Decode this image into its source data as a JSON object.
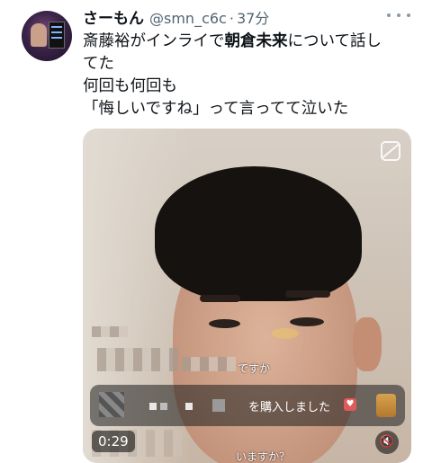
{
  "tweet": {
    "display_name": "さーもん",
    "handle": "@smn_c6c",
    "separator": "·",
    "time": "37分",
    "text": {
      "line1_pre": "斎藤裕がインライで",
      "line1_bold": "朝倉未来",
      "line1_post": "について話し",
      "line2": "てた",
      "line3": "何回も何回も",
      "line4": "「悔しいですね」って言ってて泣いた"
    }
  },
  "media": {
    "timer": "0:29",
    "purchase_text": "を購入しました",
    "comment_1": "ですか",
    "comment_2": "いますか？",
    "live_icon": "live-off-icon",
    "mute_icon": "speaker-muted-icon"
  },
  "icons": {
    "avatar": "user-avatar",
    "more": "more-horizontal-icon"
  },
  "colors": {
    "text_primary": "#0f1419",
    "text_secondary": "#536471",
    "background": "#ffffff"
  }
}
